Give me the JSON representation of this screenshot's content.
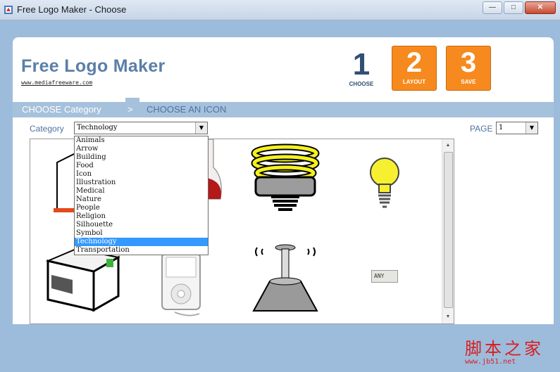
{
  "window": {
    "title": "Free Logo Maker - Choose",
    "minimize": "—",
    "maximize": "□",
    "close": "✕"
  },
  "header": {
    "app_name": "Free Logo Maker",
    "url": "www.mediafreeware.com",
    "steps": [
      {
        "number": "1",
        "label": "CHOOSE"
      },
      {
        "number": "2",
        "label": "LAYOUT"
      },
      {
        "number": "3",
        "label": "SAVE"
      }
    ]
  },
  "nav": {
    "active": "CHOOSE Category",
    "separator": ">",
    "next": "CHOOSE AN ICON"
  },
  "controls": {
    "category_label": "Category",
    "category_value": "Technology",
    "page_label": "PAGE",
    "page_value": "1"
  },
  "category_options": [
    "Animals",
    "Arrow",
    "Building",
    "Food",
    "Icon",
    "Illustration",
    "Medical",
    "Nature",
    "People",
    "Religion",
    "Silhouette",
    "Symbol",
    "Technology",
    "Transportation"
  ],
  "selected_option_index": 12,
  "gallery": {
    "icons": [
      {
        "name": "building-icon"
      },
      {
        "name": "flask-icon"
      },
      {
        "name": "cfl-bulb-icon"
      },
      {
        "name": "light-bulb-icon"
      },
      {
        "name": "printer-icon"
      },
      {
        "name": "ipod-icon"
      },
      {
        "name": "joystick-icon"
      },
      {
        "name": "any-key-icon",
        "text": "ANY"
      }
    ]
  },
  "watermark": {
    "cn": "脚本之家",
    "url": "www.jb51.net"
  },
  "colors": {
    "accent": "#f68a1e",
    "title": "#5a7fa8",
    "nav": "#a6c1dc",
    "selection": "#3399ff"
  }
}
